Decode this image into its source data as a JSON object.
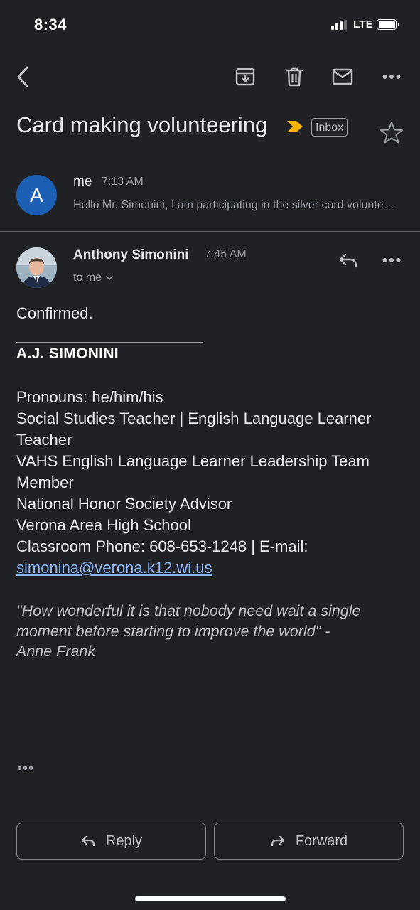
{
  "status_bar": {
    "time": "8:34",
    "network": "LTE"
  },
  "toolbar": {
    "back_icon": "chevron-left-icon",
    "archive_icon": "archive-icon",
    "delete_icon": "trash-icon",
    "mark_unread_icon": "mail-icon",
    "more_icon": "more-horizontal-icon"
  },
  "thread": {
    "subject": "Card making volunteering",
    "label": "Inbox",
    "importance_color": "#f4b400"
  },
  "collapsed_message": {
    "avatar_letter": "A",
    "avatar_color": "#1a5fb4",
    "sender": "me",
    "time": "7:13 AM",
    "snippet": "Hello Mr. Simonini, I am participating in the silver cord volunteering for card making"
  },
  "expanded_message": {
    "sender": "Anthony Simonini",
    "time": "7:45 AM",
    "recipient": "to me",
    "body": "Confirmed.",
    "signature": {
      "name": "A.J. SIMONINI",
      "lines": [
        "Pronouns: he/him/his",
        "Social Studies Teacher | English Language Learner",
        "Teacher",
        "VAHS English Language Learner Leadership Team",
        "Member",
        "National Honor Society Advisor",
        "Verona Area High School",
        "Classroom Phone: 608-653-1248 | E-mail:"
      ],
      "email": "simonina@verona.k12.wi.us",
      "quote_lines": [
        "\"How wonderful it is that nobody need wait a single",
        "moment before starting to improve the world\" -",
        "Anne Frank"
      ]
    },
    "trimmed_content": "•••"
  },
  "actions": {
    "reply_label": "Reply",
    "forward_label": "Forward"
  }
}
